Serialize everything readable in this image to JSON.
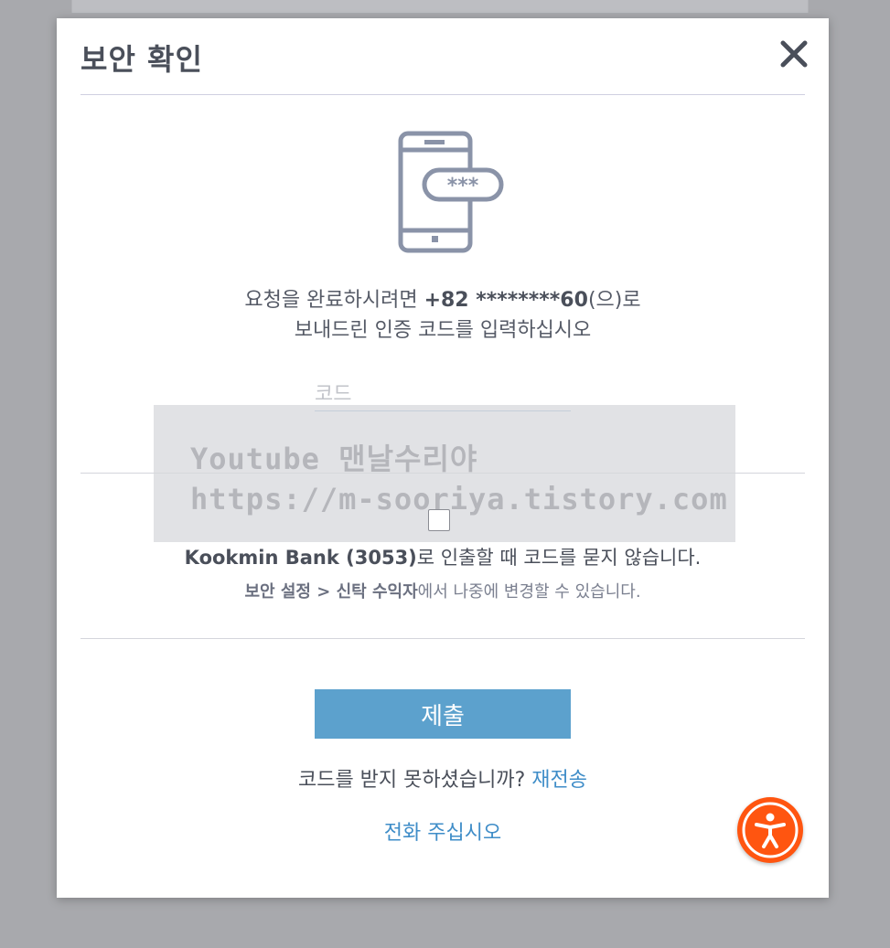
{
  "modal": {
    "title": "보안 확인"
  },
  "instruction": {
    "line1_prefix": "요청을 완료하시려면 ",
    "phone_masked": "+82 ********60",
    "line1_suffix": "(으)로",
    "line2": "보내드린 인증 코드를 입력하십시오"
  },
  "code_input": {
    "placeholder": "코드",
    "value": ""
  },
  "watermark": {
    "line1": "Youtube 맨날수리야",
    "line2": "https://m-sooriya.tistory.com"
  },
  "remember": {
    "checked": false,
    "bank_name": "Kookmin Bank (3053)",
    "text": "로 인출할 때 코드를 묻지 않습니다."
  },
  "settings_hint": {
    "path_part1": "보안 설정",
    "separator": " > ",
    "path_part2": "신탁 수익자",
    "text": "에서 나중에 변경할 수 있습니다."
  },
  "submit": {
    "label": "제출"
  },
  "resend": {
    "question": "코드를 받지 못하셨습니까? ",
    "link_label": "재전송"
  },
  "call": {
    "link_label": "전화 주십시오"
  },
  "colors": {
    "primary_button": "#5ca1cd",
    "link": "#3f8dc8",
    "accessibility_button": "#ff5510",
    "title_text": "#4a4f5a"
  },
  "icons": {
    "close": "close-icon",
    "phone_code": "phone-code-icon",
    "accessibility": "accessibility-icon"
  }
}
